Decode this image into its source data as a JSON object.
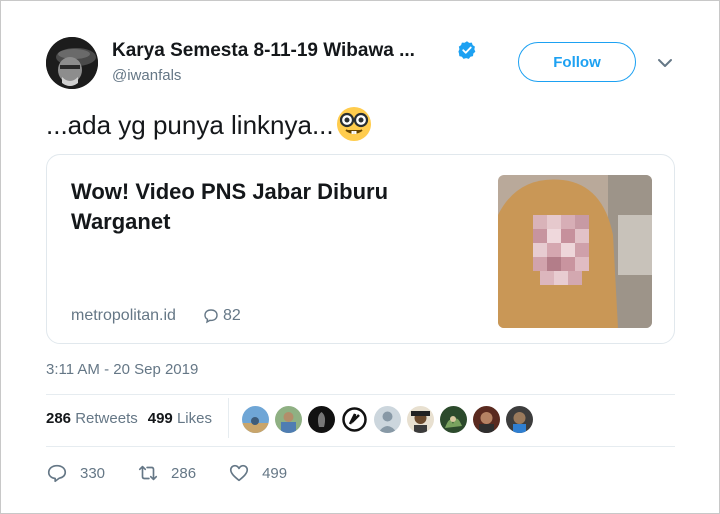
{
  "author": {
    "name": "Karya Semesta 8-11-19 Wibawa ...",
    "handle": "@iwanfals",
    "verified": true
  },
  "follow_label": "Follow",
  "tweet_text": "...ada yg punya linknya...",
  "tweet_emoji": "nerd-face-emoji",
  "card": {
    "title": "Wow! Video PNS Jabar Diburu Warganet",
    "domain": "metropolitan.id",
    "comment_count": "82"
  },
  "timestamp": "3:11 AM - 20 Sep 2019",
  "stats": {
    "retweets_count": "286",
    "retweets_label": "Retweets",
    "likes_count": "499",
    "likes_label": "Likes"
  },
  "actions": {
    "replies": "330",
    "retweets": "286",
    "likes": "499"
  },
  "colors": {
    "accent": "#1da1f2",
    "muted": "#657786",
    "border": "#e1e8ed"
  }
}
